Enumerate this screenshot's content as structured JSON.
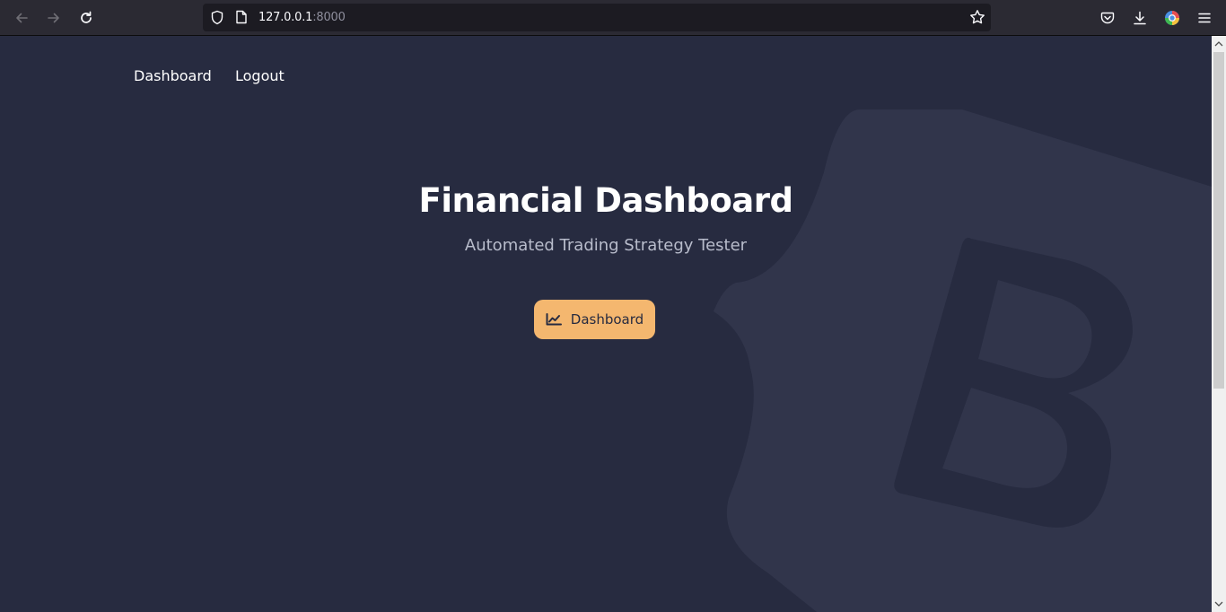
{
  "browser": {
    "url_host": "127.0.0.1",
    "url_port": ":8000"
  },
  "nav": {
    "items": [
      {
        "label": "Dashboard"
      },
      {
        "label": "Logout"
      }
    ]
  },
  "hero": {
    "title": "Financial Dashboard",
    "subtitle": "Automated Trading Strategy Tester",
    "button_label": "Dashboard",
    "button_icon": "chart-line-icon"
  },
  "colors": {
    "page_background": "#272b40",
    "accent_button": "#f4b76f",
    "subtitle_text": "#b8bccb"
  }
}
